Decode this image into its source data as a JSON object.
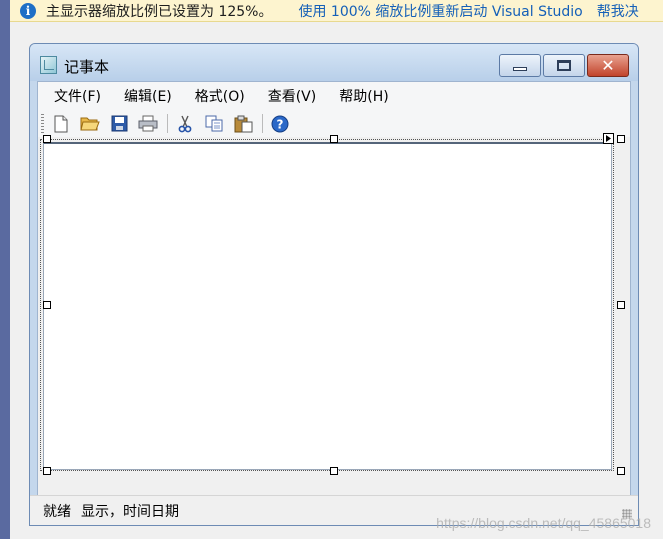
{
  "infobar": {
    "message": "主显示器缩放比例已设置为 125%。",
    "restart_link": "使用 100% 缩放比例重新启动 Visual Studio",
    "help_link": "帮我决"
  },
  "window": {
    "title": "记事本",
    "menu": [
      "文件(F)",
      "编辑(E)",
      "格式(O)",
      "查看(V)",
      "帮助(H)"
    ],
    "toolbar_icons": [
      "new-file-icon",
      "open-folder-icon",
      "save-icon",
      "print-icon",
      "cut-icon",
      "copy-icon",
      "paste-icon",
      "help-icon"
    ],
    "status": {
      "ready": "就绪",
      "datetime": "显示，时间日期"
    }
  },
  "watermark": "https://blog.csdn.net/qq_45865018",
  "colors": {
    "infobar_bg": "#fdf4cf",
    "link": "#1560b8",
    "titlebar": "#c4d7ec",
    "close_button": "#c1442c"
  }
}
